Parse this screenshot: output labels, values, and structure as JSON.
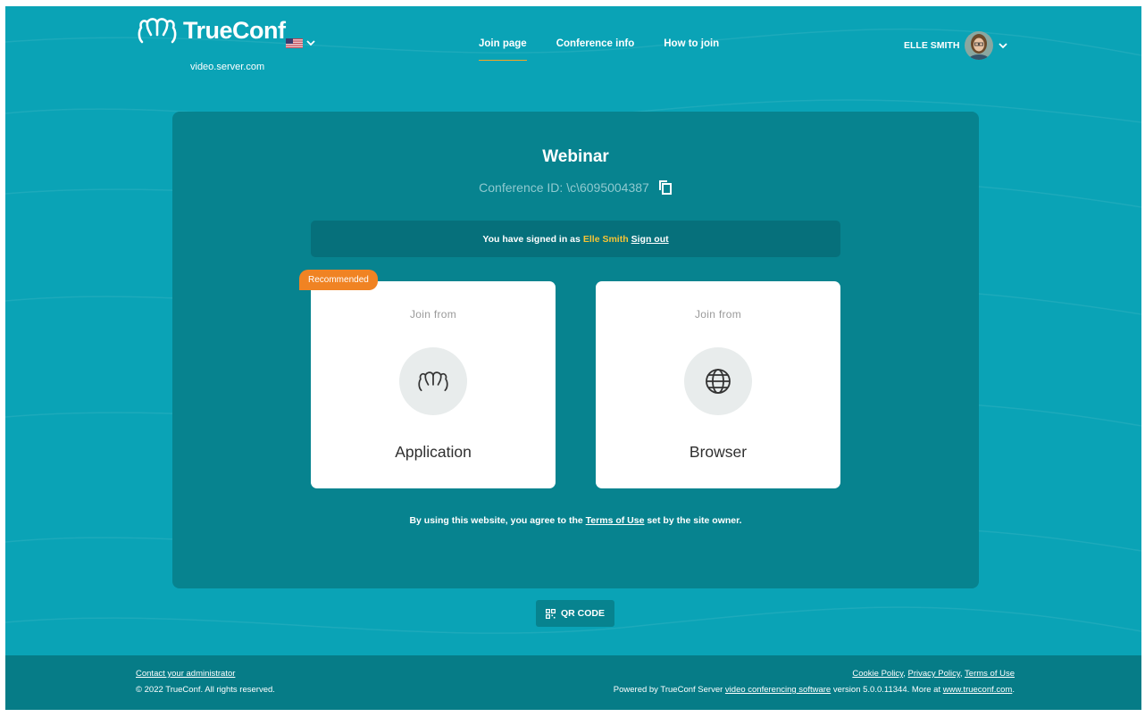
{
  "header": {
    "brand_name": "TrueConf",
    "server": "video.server.com",
    "language_icon": "us-flag-icon",
    "nav": [
      {
        "label": "Join page"
      },
      {
        "label": "Conference info"
      },
      {
        "label": "How to join"
      }
    ],
    "user_name": "ELLE SMITH"
  },
  "main": {
    "title": "Webinar",
    "conference_id": "Conference ID: \\c\\6095004387",
    "signed_in": {
      "prefix": "You have signed in as",
      "user": "Elle Smith",
      "sign_out": "Sign out"
    },
    "badge": "Recommended",
    "options": [
      {
        "join_from": "Join from",
        "label": "Application",
        "icon": "trueconf-app-icon"
      },
      {
        "join_from": "Join from",
        "label": "Browser",
        "icon": "globe-icon"
      }
    ],
    "terms": {
      "prefix": "By using this website, you agree to the",
      "link": "Terms of Use",
      "suffix": "set by the site owner."
    },
    "qr_button": "QR CODE"
  },
  "footer": {
    "contact": "Contact your administrator",
    "copyright": "© 2022 TrueConf. All rights reserved.",
    "cookie": "Cookie Policy",
    "privacy": "Privacy Policy",
    "terms": "Terms of Use",
    "powered_prefix": "Powered by TrueConf Server",
    "powered_link": "video conferencing software",
    "powered_mid": "version 5.0.0.11344. More at",
    "site_link": "www.trueconf.com",
    "powered_end": "."
  },
  "colors": {
    "background": "#0aa3b6",
    "card": "#07838f",
    "accent": "#f5a623",
    "badge": "#f08323",
    "username_highlight": "#f6c435"
  }
}
